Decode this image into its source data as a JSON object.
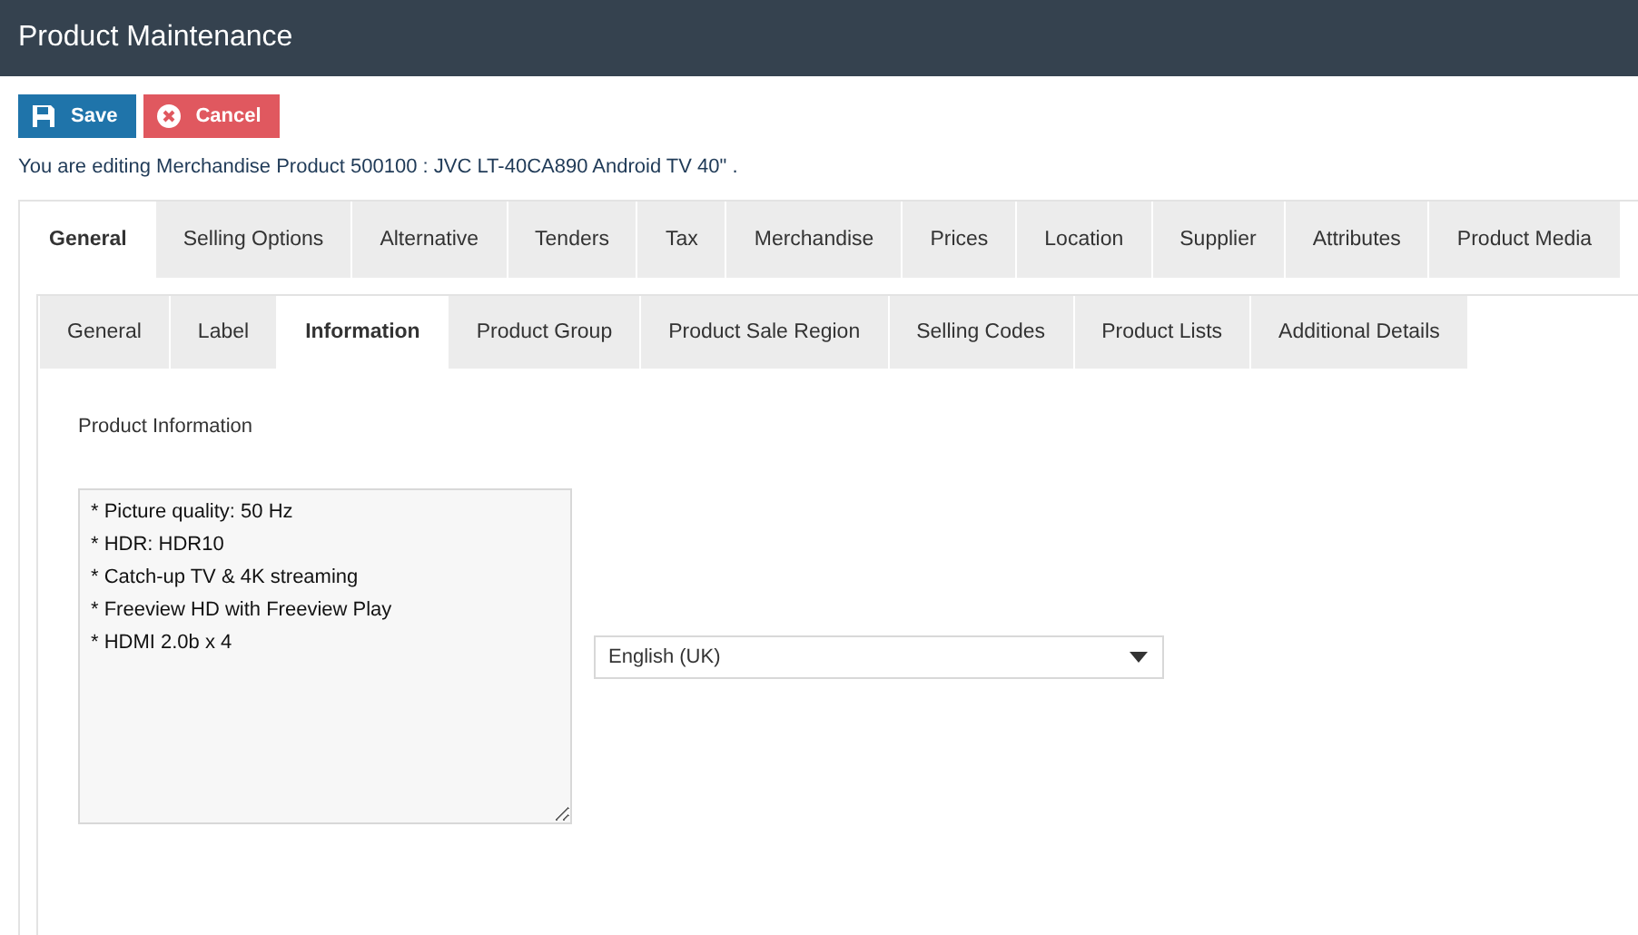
{
  "window": {
    "title": "Product Maintenance"
  },
  "buttons": [
    {
      "label": "Save",
      "kind": "save"
    },
    {
      "label": "Cancel",
      "kind": "cancel"
    }
  ],
  "editing_message": "You are editing Merchandise Product 500100 : JVC LT-40CA890 Android TV 40\" .",
  "tabs": [
    {
      "label": "General",
      "selected": true
    },
    {
      "label": "Selling Options",
      "selected": false
    },
    {
      "label": "Alternative",
      "selected": false
    },
    {
      "label": "Tenders",
      "selected": false
    },
    {
      "label": "Tax",
      "selected": false
    },
    {
      "label": "Merchandise",
      "selected": false
    },
    {
      "label": "Prices",
      "selected": false
    },
    {
      "label": "Location",
      "selected": false
    },
    {
      "label": "Supplier",
      "selected": false
    },
    {
      "label": "Attributes",
      "selected": false
    },
    {
      "label": "Product Media",
      "selected": false
    }
  ],
  "subtabs": [
    {
      "label": "General",
      "selected": false
    },
    {
      "label": "Label",
      "selected": false
    },
    {
      "label": "Information",
      "selected": true
    },
    {
      "label": "Product Group",
      "selected": false
    },
    {
      "label": "Product Sale Region",
      "selected": false
    },
    {
      "label": "Selling Codes",
      "selected": false
    },
    {
      "label": "Product Lists",
      "selected": false
    },
    {
      "label": "Additional Details",
      "selected": false
    }
  ],
  "section_title": "Product Information",
  "description": {
    "value": "* Picture quality: 50 Hz\n* HDR: HDR10\n* Catch-up TV & 4K streaming\n* Freeview HD with Freeview Play\n* HDMI 2.0b x 4"
  },
  "language_select": {
    "value": "English (UK)"
  }
}
